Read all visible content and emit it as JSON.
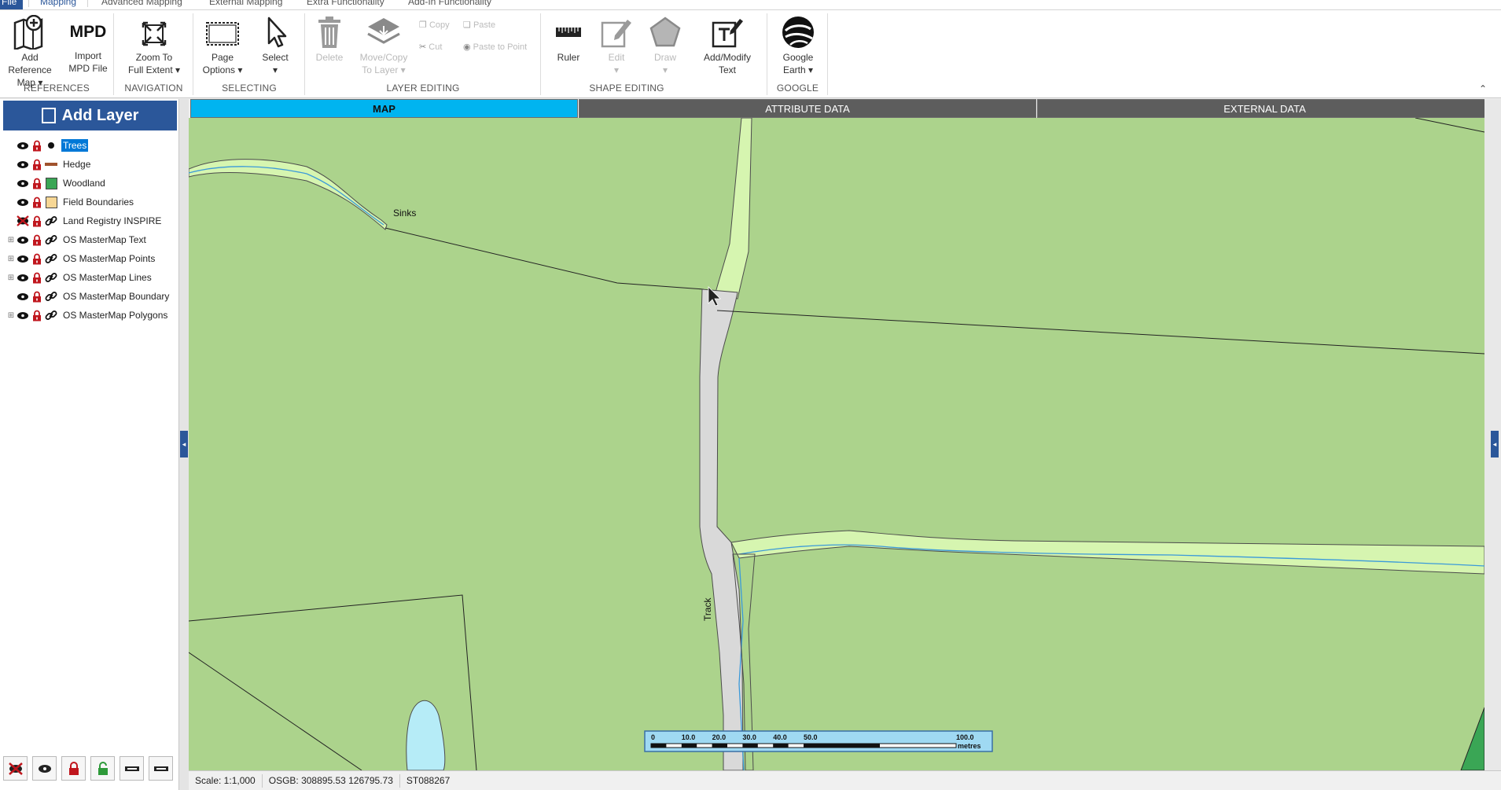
{
  "ribbon_tabs": [
    "File",
    "Mapping",
    "Advanced Mapping",
    "External Mapping",
    "Extra Functionality",
    "Add-In Functionality"
  ],
  "active_tab": "Mapping",
  "groups": {
    "references": {
      "label": "REFERENCES",
      "add_reference_map": "Add Reference",
      "add_reference_map_2": "Map",
      "import_mpd": "Import",
      "import_mpd_2": "MPD File",
      "mpd_icon_text": "MPD"
    },
    "navigation": {
      "label": "NAVIGATION",
      "zoom": "Zoom To",
      "zoom_2": "Full Extent"
    },
    "selecting": {
      "label": "SELECTING",
      "page_options": "Page",
      "page_options_2": "Options",
      "select": "Select"
    },
    "layer_editing": {
      "label": "LAYER EDITING",
      "delete": "Delete",
      "move_copy": "Move/Copy",
      "move_copy_2": "To Layer",
      "copy": "Copy",
      "paste": "Paste",
      "cut": "Cut",
      "paste_to_point": "Paste to Point"
    },
    "shape_editing": {
      "label": "SHAPE EDITING",
      "ruler": "Ruler",
      "edit": "Edit",
      "draw": "Draw",
      "add_modify": "Add/Modify",
      "add_modify_2": "Text"
    },
    "google": {
      "label": "GOOGLE",
      "google_earth": "Google",
      "google_earth_2": "Earth"
    }
  },
  "left_panel": {
    "add_layer": "Add Layer",
    "layers": [
      {
        "name": "Trees",
        "selected": true,
        "expandable": false,
        "visible": true,
        "type": "point"
      },
      {
        "name": "Hedge",
        "selected": false,
        "expandable": false,
        "visible": true,
        "type": "line"
      },
      {
        "name": "Woodland",
        "selected": false,
        "expandable": false,
        "visible": true,
        "type": "polygon-green"
      },
      {
        "name": "Field Boundaries",
        "selected": false,
        "expandable": false,
        "visible": true,
        "type": "polygon-tan"
      },
      {
        "name": "Land Registry INSPIRE",
        "selected": false,
        "expandable": false,
        "visible": false,
        "type": "link"
      },
      {
        "name": "OS MasterMap Text",
        "selected": false,
        "expandable": true,
        "visible": true,
        "type": "link"
      },
      {
        "name": "OS MasterMap Points",
        "selected": false,
        "expandable": true,
        "visible": true,
        "type": "link"
      },
      {
        "name": "OS MasterMap Lines",
        "selected": false,
        "expandable": true,
        "visible": true,
        "type": "link"
      },
      {
        "name": "OS MasterMap Boundary",
        "selected": false,
        "expandable": false,
        "visible": true,
        "type": "link"
      },
      {
        "name": "OS MasterMap Polygons",
        "selected": false,
        "expandable": true,
        "visible": true,
        "type": "link"
      }
    ]
  },
  "view_tabs": [
    "MAP",
    "ATTRIBUTE DATA",
    "EXTERNAL DATA"
  ],
  "active_view_tab": "MAP",
  "map": {
    "labels": {
      "sinks": "Sinks",
      "track": "Track"
    },
    "scale_bar": {
      "ticks": [
        "0",
        "10.0",
        "20.0",
        "30.0",
        "40.0",
        "50.0",
        "100.0"
      ],
      "unit": "metres"
    }
  },
  "status": {
    "scale": "Scale: 1:1,000",
    "coords": "OSGB: 308895.53  126795.73",
    "grid_ref": "ST088267"
  },
  "colors": {
    "accent": "#2b579a",
    "tab_active": "#00b4f0",
    "field": "#acd38c",
    "track": "#d9d9d9",
    "stream_bank": "#d6f5b0",
    "water": "#3b9ad9",
    "pond": "#b6ecf7",
    "lock": "#c0161d"
  }
}
